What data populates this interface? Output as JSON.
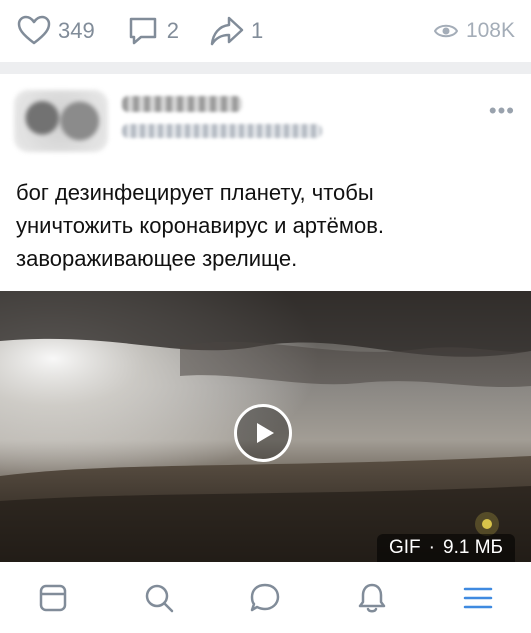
{
  "prev_post_actions": {
    "likes": "349",
    "comments": "2",
    "shares": "1",
    "views": "108K"
  },
  "post": {
    "text_lines": [
      "бог дезинфецирует планету, чтобы",
      "уничтожить коронавирус и артёмов.",
      "завораживающее зрелище."
    ],
    "more_label": "•••",
    "media": {
      "type_label": "GIF",
      "separator": "·",
      "size_label": "9.1 МБ"
    }
  },
  "colors": {
    "icon_gray": "#818c99",
    "nav_blue": "#3f8ae0"
  },
  "tabbar": {
    "items": [
      "news-tab",
      "search-tab",
      "messages-tab",
      "notifications-tab",
      "menu-tab"
    ]
  }
}
